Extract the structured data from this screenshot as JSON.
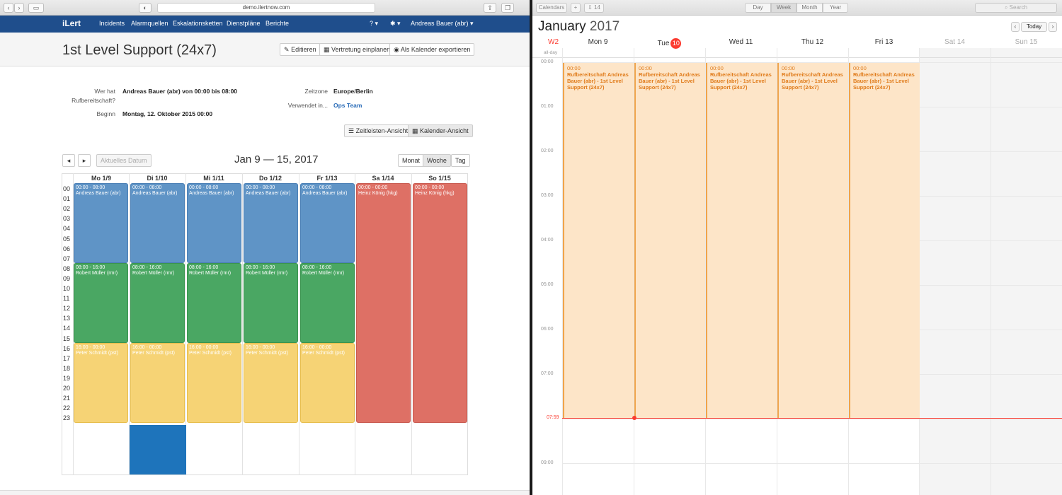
{
  "browser": {
    "url": "demo.ilertnow.com"
  },
  "nav": {
    "logo": "iLert",
    "items": [
      "Incidents",
      "Alarmquellen",
      "Eskalationsketten",
      "Dienstpläne",
      "Berichte"
    ],
    "help": "?",
    "user": "Andreas Bauer (abr)"
  },
  "page": {
    "title": "1st Level Support (24x7)",
    "actions": {
      "edit": "Editieren",
      "substitute": "Vertretung einplanen",
      "export": "Als Kalender exportieren"
    },
    "info": {
      "oncall_label_1": "Wer hat",
      "oncall_label_2": "Rufbereitschaft?",
      "oncall_value": "Andreas Bauer (abr) von 00:00 bis 08:00",
      "start_label": "Beginn",
      "start_value": "Montag, 12. Oktober 2015 00:00",
      "timezone_label": "Zeitzone",
      "timezone_value": "Europe/Berlin",
      "used_label": "Verwendet in...",
      "used_value": "Ops Team"
    },
    "views": {
      "timeline": "Zeitleisten-Ansicht",
      "calendar": "Kalender-Ansicht"
    },
    "calendar": {
      "current_date": "Aktuelles Datum",
      "range": "Jan 9 — 15, 2017",
      "modes": {
        "month": "Monat",
        "week": "Woche",
        "day": "Tag"
      },
      "days": [
        "Mo 1/9",
        "Di 1/10",
        "Mi 1/11",
        "Do 1/12",
        "Fr 1/13",
        "Sa 1/14",
        "So 1/15"
      ],
      "hours": [
        "00",
        "01",
        "02",
        "03",
        "04",
        "05",
        "06",
        "07",
        "08",
        "09",
        "10",
        "11",
        "12",
        "13",
        "14",
        "15",
        "16",
        "17",
        "18",
        "19",
        "20",
        "21",
        "22",
        "23"
      ],
      "shifts": {
        "morning_time": "00:00 - 08:00",
        "morning_name": "Andreas Bauer (abr)",
        "day_time": "08:00 - 16:00",
        "day_name": "Robert Müller (rmr)",
        "evening_time": "16:00 - 00:00",
        "evening_name": "Peter Schmidt (pst)",
        "weekend_time": "00:00 - 00:00",
        "weekend_name": "Heinz König (hkg)"
      }
    }
  },
  "mac_calendar": {
    "toolbar": {
      "calendars": "Calendars",
      "add": "+",
      "inbox_count": "14",
      "day": "Day",
      "week": "Week",
      "month": "Month",
      "year": "Year",
      "search": "Search",
      "today": "Today"
    },
    "month": "January",
    "year": "2017",
    "week_label": "W2",
    "days": [
      {
        "name": "Mon",
        "num": "9"
      },
      {
        "name": "Tue",
        "num": "10"
      },
      {
        "name": "Wed",
        "num": "11"
      },
      {
        "name": "Thu",
        "num": "12"
      },
      {
        "name": "Fri",
        "num": "13"
      },
      {
        "name": "Sat",
        "num": "14"
      },
      {
        "name": "Sun",
        "num": "15"
      }
    ],
    "allday": "all-day",
    "hours": [
      "00:00",
      "01:00",
      "02:00",
      "03:00",
      "04:00",
      "05:00",
      "06:00",
      "07:00",
      "09:00"
    ],
    "now": "07:59",
    "event_time": "00:00",
    "event_title": "Rufbereitschaft Andreas Bauer (abr) - 1st Level Support (24x7)"
  }
}
